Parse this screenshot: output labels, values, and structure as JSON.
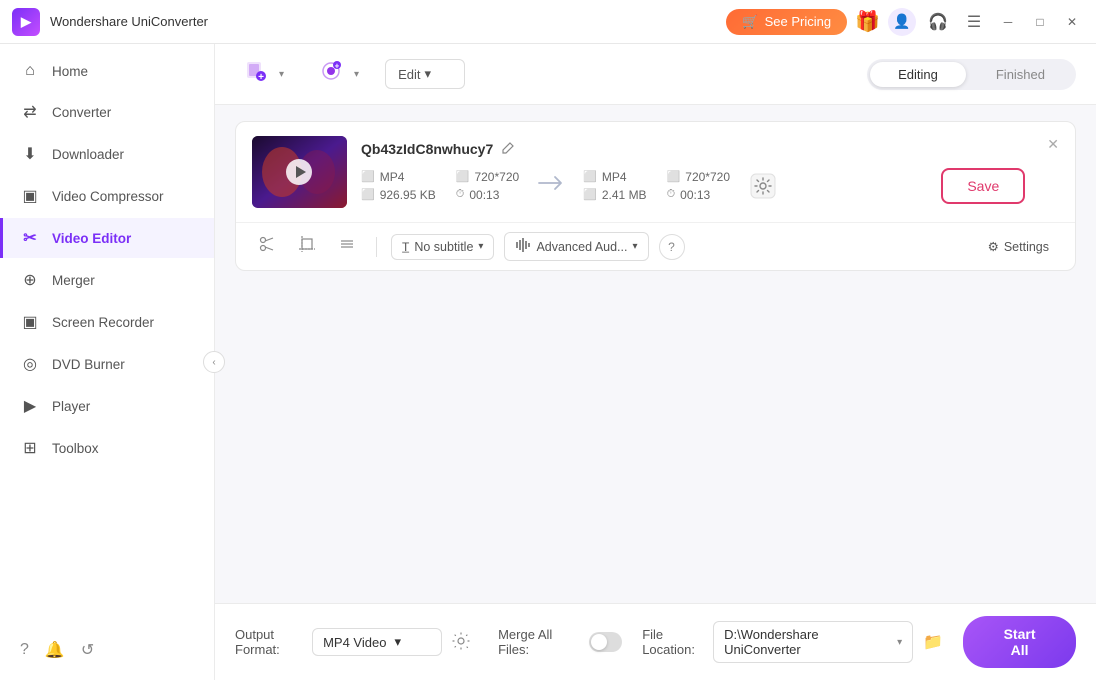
{
  "app": {
    "title": "Wondershare UniConverter",
    "logo_text": "W"
  },
  "titlebar": {
    "see_pricing": "See Pricing",
    "cart_icon": "🛒",
    "gift_icon": "🎁",
    "user_icon": "👤",
    "headset_icon": "🎧",
    "menu_icon": "☰",
    "minimize_icon": "─",
    "maximize_icon": "□",
    "close_icon": "✕"
  },
  "sidebar": {
    "items": [
      {
        "id": "home",
        "label": "Home",
        "icon": "⌂"
      },
      {
        "id": "converter",
        "label": "Converter",
        "icon": "⇄"
      },
      {
        "id": "downloader",
        "label": "Downloader",
        "icon": "⬇"
      },
      {
        "id": "video-compressor",
        "label": "Video Compressor",
        "icon": "⊞"
      },
      {
        "id": "video-editor",
        "label": "Video Editor",
        "icon": "✂",
        "active": true
      },
      {
        "id": "merger",
        "label": "Merger",
        "icon": "⊕"
      },
      {
        "id": "screen-recorder",
        "label": "Screen Recorder",
        "icon": "▣"
      },
      {
        "id": "dvd-burner",
        "label": "DVD Burner",
        "icon": "◎"
      },
      {
        "id": "player",
        "label": "Player",
        "icon": "▶"
      },
      {
        "id": "toolbox",
        "label": "Toolbox",
        "icon": "⊞"
      }
    ],
    "bottom_icons": [
      "?",
      "🔔",
      "↺"
    ],
    "collapse_icon": "‹"
  },
  "toolbar": {
    "add_file_label": "Add File",
    "add_record_label": "Record",
    "edit_dropdown_label": "Edit",
    "edit_dropdown_icon": "▾",
    "tab_editing": "Editing",
    "tab_finished": "Finished"
  },
  "file_card": {
    "filename": "Qb43zIdC8nwhucy7",
    "edit_icon": "⬡",
    "source": {
      "format": "MP4",
      "resolution": "720*720",
      "size": "926.95 KB",
      "duration": "00:13"
    },
    "output": {
      "format": "MP4",
      "resolution": "720*720",
      "size": "2.41 MB",
      "duration": "00:13"
    },
    "settings_icon": "⚙",
    "save_label": "Save",
    "close_icon": "✕",
    "tools": {
      "cut_icon": "✂",
      "crop_icon": "⬜",
      "effects_icon": "≡"
    },
    "subtitle_label": "No subtitle",
    "audio_label": "Advanced Aud...",
    "info_icon": "?",
    "settings_label": "Settings"
  },
  "bottom_bar": {
    "output_format_label": "Output Format:",
    "output_format_value": "MP4 Video",
    "format_icon": "▾",
    "settings_icon": "⚙",
    "merge_label": "Merge All Files:",
    "file_location_label": "File Location:",
    "file_location_value": "D:\\Wondershare UniConverter",
    "file_location_icon": "▾",
    "folder_icon": "📁",
    "start_all_label": "Start All"
  }
}
